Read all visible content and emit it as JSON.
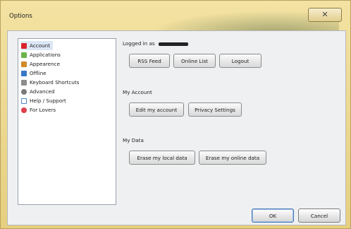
{
  "window": {
    "title": "Options",
    "close_glyph": "✕"
  },
  "sidebar": {
    "items": [
      {
        "label": "Account",
        "icon": "account-icon",
        "color": "#d8242b",
        "selected": true
      },
      {
        "label": "Applications",
        "icon": "applications-icon",
        "color": "#6bb34a",
        "selected": false
      },
      {
        "label": "Appearence",
        "icon": "appearance-icon",
        "color": "#d08a2a",
        "selected": false
      },
      {
        "label": "Offline",
        "icon": "offline-icon",
        "color": "#3b78c4",
        "selected": false
      },
      {
        "label": "Keyboard Shortcuts",
        "icon": "keyboard-icon",
        "color": "#8c8c8c",
        "selected": false
      },
      {
        "label": "Advanced",
        "icon": "advanced-icon",
        "color": "#7a7a7a",
        "selected": false
      },
      {
        "label": "Help / Support",
        "icon": "help-icon",
        "color": "#4d84c8",
        "selected": false
      },
      {
        "label": "For Lovers",
        "icon": "heart-icon",
        "color": "#e0404a",
        "selected": false
      }
    ]
  },
  "account": {
    "logged_in_prefix": "Logged in as",
    "rss_feed": "RSS Feed",
    "online_list": "Online List",
    "logout": "Logout"
  },
  "my_account": {
    "heading": "My Account",
    "edit": "Edit my account",
    "privacy": "Privacy Settings"
  },
  "my_data": {
    "heading": "My Data",
    "erase_local": "Erase my local data",
    "erase_online": "Erase my online data"
  },
  "footer": {
    "ok": "OK",
    "cancel": "Cancel"
  }
}
